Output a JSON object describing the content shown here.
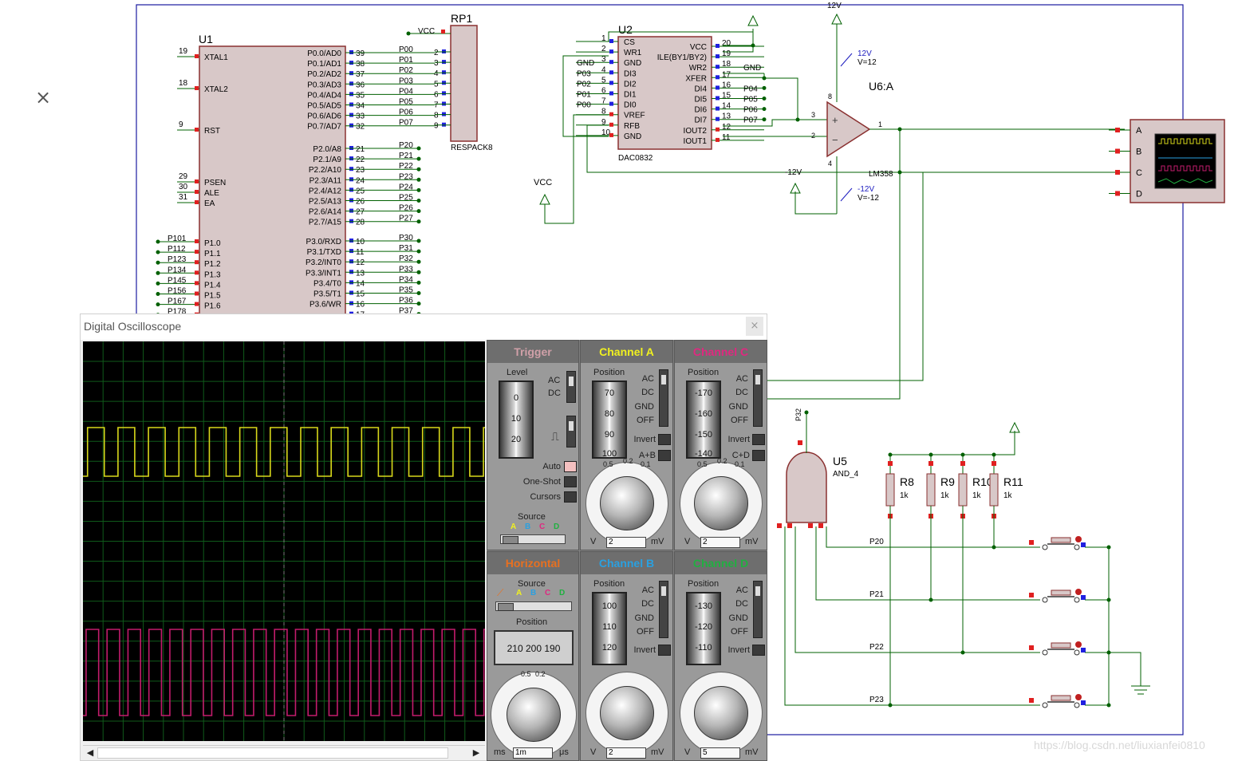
{
  "schematic": {
    "u1": {
      "ref": "U1",
      "left_pins": [
        {
          "num": "19",
          "name": "XTAL1"
        },
        {
          "num": "18",
          "name": "XTAL2"
        },
        {
          "num": "9",
          "name": "RST"
        },
        {
          "num": "29",
          "name": "PSEN"
        },
        {
          "num": "30",
          "name": "ALE"
        },
        {
          "num": "31",
          "name": "EA"
        }
      ],
      "p0_pins": [
        {
          "name": "P0.0/AD0",
          "num": "39",
          "net": "P00"
        },
        {
          "name": "P0.1/AD1",
          "num": "38",
          "net": "P01"
        },
        {
          "name": "P0.2/AD2",
          "num": "37",
          "net": "P02"
        },
        {
          "name": "P0.3/AD3",
          "num": "36",
          "net": "P03"
        },
        {
          "name": "P0.4/AD4",
          "num": "35",
          "net": "P04"
        },
        {
          "name": "P0.5/AD5",
          "num": "34",
          "net": "P05"
        },
        {
          "name": "P0.6/AD6",
          "num": "33",
          "net": "P06"
        },
        {
          "name": "P0.7/AD7",
          "num": "32",
          "net": "P07"
        }
      ],
      "p2_pins": [
        {
          "name": "P2.0/A8",
          "num": "21",
          "net": "P20"
        },
        {
          "name": "P2.1/A9",
          "num": "22",
          "net": "P21"
        },
        {
          "name": "P2.2/A10",
          "num": "23",
          "net": "P22"
        },
        {
          "name": "P2.3/A11",
          "num": "24",
          "net": "P23"
        },
        {
          "name": "P2.4/A12",
          "num": "25",
          "net": "P24"
        },
        {
          "name": "P2.5/A13",
          "num": "26",
          "net": "P25"
        },
        {
          "name": "P2.6/A14",
          "num": "27",
          "net": "P26"
        },
        {
          "name": "P2.7/A15",
          "num": "28",
          "net": "P27"
        }
      ],
      "p3_pins": [
        {
          "name": "P3.0/RXD",
          "num": "10",
          "net": "P30"
        },
        {
          "name": "P3.1/TXD",
          "num": "11",
          "net": "P31"
        },
        {
          "name": "P3.2/INT0",
          "num": "12",
          "net": "P32"
        },
        {
          "name": "P3.3/INT1",
          "num": "13",
          "net": "P33"
        },
        {
          "name": "P3.4/T0",
          "num": "14",
          "net": "P34"
        },
        {
          "name": "P3.5/T1",
          "num": "15",
          "net": "P35"
        },
        {
          "name": "P3.6/WR",
          "num": "16",
          "net": "P36"
        },
        {
          "name": "",
          "num": "17",
          "net": "P37"
        }
      ],
      "p1_pins": [
        {
          "name": "P1.0",
          "net": "P101"
        },
        {
          "name": "P1.1",
          "net": "P112"
        },
        {
          "name": "P1.2",
          "net": "P123"
        },
        {
          "name": "P1.3",
          "net": "P134"
        },
        {
          "name": "P1.4",
          "net": "P145"
        },
        {
          "name": "P1.5",
          "net": "P156"
        },
        {
          "name": "P1.6",
          "net": "P167"
        },
        {
          "name": "",
          "net": "P178"
        }
      ]
    },
    "rp1": {
      "ref": "RP1",
      "type": "RESPACK8",
      "vcc": "VCC",
      "nets": [
        "P00",
        "P01",
        "P02",
        "P03",
        "P04",
        "P05",
        "P06",
        "P07"
      ],
      "pins": [
        "2",
        "3",
        "4",
        "5",
        "6",
        "7",
        "8",
        "9"
      ]
    },
    "u2": {
      "ref": "U2",
      "type": "DAC0832",
      "left": [
        {
          "num": "1",
          "name": "CS",
          "net": ""
        },
        {
          "num": "2",
          "name": "WR1",
          "net": ""
        },
        {
          "num": "3",
          "name": "GND",
          "net": "GND"
        },
        {
          "num": "4",
          "name": "DI3",
          "net": "P03"
        },
        {
          "num": "5",
          "name": "DI2",
          "net": "P02"
        },
        {
          "num": "6",
          "name": "DI1",
          "net": "P01"
        },
        {
          "num": "7",
          "name": "DI0",
          "net": "P00"
        },
        {
          "num": "8",
          "name": "VREF",
          "net": ""
        },
        {
          "num": "9",
          "name": "RFB",
          "net": ""
        },
        {
          "num": "10",
          "name": "GND",
          "net": ""
        }
      ],
      "right": [
        {
          "num": "20",
          "name": "VCC",
          "net": ""
        },
        {
          "num": "19",
          "name": "ILE(BY1/BY2)",
          "net": ""
        },
        {
          "num": "18",
          "name": "WR2",
          "net": "GND"
        },
        {
          "num": "17",
          "name": "XFER",
          "net": ""
        },
        {
          "num": "16",
          "name": "DI4",
          "net": "P04"
        },
        {
          "num": "15",
          "name": "DI5",
          "net": "P05"
        },
        {
          "num": "14",
          "name": "DI6",
          "net": "P06"
        },
        {
          "num": "13",
          "name": "DI7",
          "net": "P07"
        },
        {
          "num": "12",
          "name": "IOUT2",
          "net": ""
        },
        {
          "num": "11",
          "name": "IOUT1",
          "net": ""
        }
      ]
    },
    "vcc_label": "VCC",
    "op_amp": {
      "ref": "U6:A",
      "type": "LM358",
      "pos_supply": "12V",
      "neg_supply": "-12V",
      "probe_pos_name": "12V",
      "probe_pos_val": "V=12",
      "probe_neg_name": "-12V",
      "probe_neg_val": "V=-12",
      "pin_plus": "3",
      "pin_minus": "2",
      "pin_out": "1",
      "pin_v8": "8",
      "pin_v4": "4"
    },
    "scope_inputs": [
      "A",
      "B",
      "C",
      "D"
    ],
    "u5": {
      "ref": "U5",
      "type": "AND_4",
      "net_top": "P32"
    },
    "resistors": [
      {
        "ref": "R8",
        "value": "1k"
      },
      {
        "ref": "R9",
        "value": "1k"
      },
      {
        "ref": "R10",
        "value": "1k"
      },
      {
        "ref": "R11",
        "value": "1k"
      }
    ],
    "switch_nets": [
      "P20",
      "P21",
      "P22",
      "P23"
    ]
  },
  "oscilloscope": {
    "title": "Digital Oscilloscope",
    "close_label": "×",
    "trigger": {
      "title": "Trigger",
      "level_label": "Level",
      "level_numbers": [
        "0",
        "10",
        "20"
      ],
      "ac": "AC",
      "dc": "DC",
      "auto": "Auto",
      "one_shot": "One-Shot",
      "cursors": "Cursors",
      "source_label": "Source",
      "source_letters": [
        "A",
        "B",
        "C",
        "D"
      ]
    },
    "channel_a": {
      "title": "Channel A",
      "position_label": "Position",
      "drum_numbers": [
        "70",
        "80",
        "90",
        "100"
      ],
      "ac": "AC",
      "dc": "DC",
      "gnd": "GND",
      "off": "OFF",
      "invert": "Invert",
      "extra": "A+B",
      "value": "2",
      "unit_left": "V",
      "unit_right": "mV",
      "dial_top": [
        "0.5",
        "0.2",
        "0.1"
      ]
    },
    "channel_c": {
      "title": "Channel C",
      "position_label": "Position",
      "drum_numbers": [
        "-170",
        "-160",
        "-150",
        "-140"
      ],
      "ac": "AC",
      "dc": "DC",
      "gnd": "GND",
      "off": "OFF",
      "invert": "Invert",
      "extra": "C+D",
      "value": "2",
      "unit_left": "V",
      "unit_right": "mV",
      "dial_top": [
        "0.5",
        "0.2",
        "0.1"
      ]
    },
    "horizontal": {
      "title": "Horizontal",
      "source_label": "Source",
      "source_letters": [
        "A",
        "B",
        "C",
        "D"
      ],
      "position_label": "Position",
      "position_numbers": [
        "210",
        "200",
        "190"
      ],
      "value": "1m",
      "unit_left": "ms",
      "unit_right": "μs",
      "dial_top": [
        "0.5",
        "0.2"
      ]
    },
    "channel_b": {
      "title": "Channel B",
      "position_label": "Position",
      "drum_numbers": [
        "100",
        "110",
        "120"
      ],
      "ac": "AC",
      "dc": "DC",
      "gnd": "GND",
      "off": "OFF",
      "invert": "Invert",
      "value": "2",
      "unit_left": "V",
      "unit_right": "mV"
    },
    "channel_d": {
      "title": "Channel D",
      "position_label": "Position",
      "drum_numbers": [
        "-130",
        "-120",
        "-110"
      ],
      "ac": "AC",
      "dc": "DC",
      "gnd": "GND",
      "off": "OFF",
      "invert": "Invert",
      "value": "5",
      "unit_left": "V",
      "unit_right": "mV"
    },
    "colors": {
      "trigger": "#d0a0a8",
      "channel_a": "#f0f020",
      "channel_b": "#2aa0e0",
      "channel_c": "#e02880",
      "channel_d": "#20b040",
      "horizontal": "#e87020",
      "grid": "#0f5a1a",
      "trace_a": "#d8d81a",
      "trace_c": "#c21c6c"
    },
    "traces": {
      "channel_a_pulses": 13,
      "channel_c_pulses": 19
    }
  },
  "watermark": "https://blog.csdn.net/liuxianfei0810"
}
